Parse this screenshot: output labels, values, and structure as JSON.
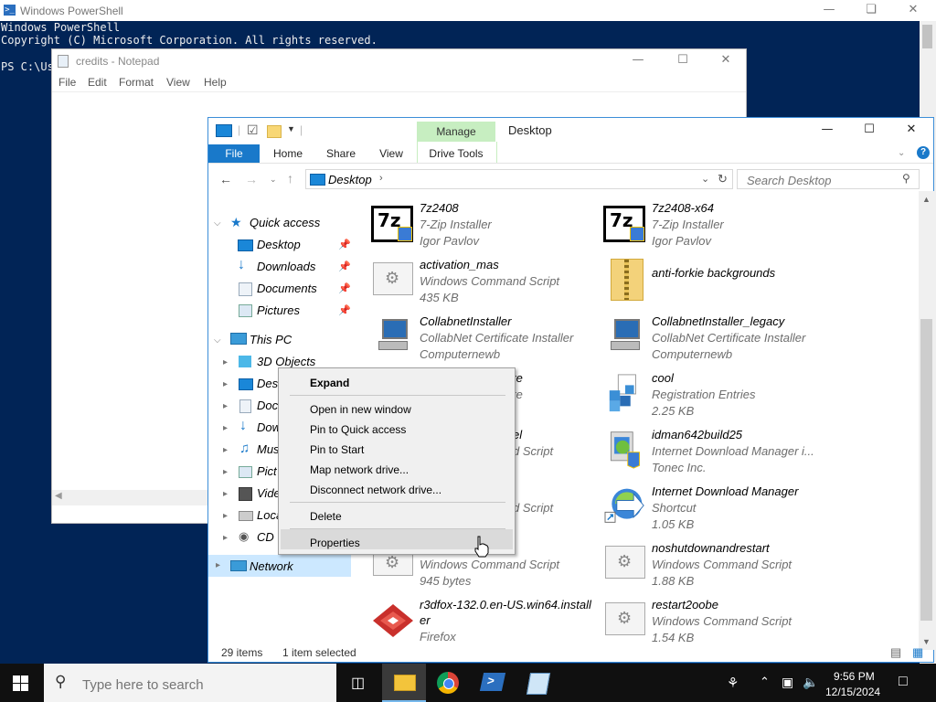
{
  "powershell": {
    "title": "Windows PowerShell",
    "line1": "Windows PowerShell",
    "line2": "Copyright (C) Microsoft Corporation. All rights reserved.",
    "prompt": "PS C:\\Us"
  },
  "notepad": {
    "title": "credits - Notepad",
    "menu": [
      "File",
      "Edit",
      "Format",
      "View",
      "Help"
    ]
  },
  "explorer": {
    "title": "Desktop",
    "manage_tab": "Manage",
    "tabs": {
      "file": "File",
      "home": "Home",
      "share": "Share",
      "view": "View",
      "drive_tools": "Drive Tools"
    },
    "address": "Desktop",
    "search_placeholder": "Search Desktop",
    "nav": {
      "quick_access": "Quick access",
      "qa_items": [
        "Desktop",
        "Downloads",
        "Documents",
        "Pictures"
      ],
      "this_pc": "This PC",
      "pc_items": [
        "3D Objects",
        "Desktop",
        "Documents",
        "Downloads",
        "Music",
        "Pictures",
        "Videos",
        "Local Disk (C:)",
        "CD Drive"
      ],
      "pc_items_visible": [
        "3D Objects",
        "Desi",
        "Doc",
        "Dow",
        "Mus",
        "Pict",
        "Vide",
        "Loca",
        "CD"
      ],
      "network": "Network"
    },
    "files_left": [
      {
        "name": "7z2408",
        "line2": "7-Zip Installer",
        "line3": "Igor Pavlov",
        "icon": "7zip-icon"
      },
      {
        "name": "activation_mas",
        "line2": "Windows Command Script",
        "line3": "435 KB",
        "icon": "script-icon"
      },
      {
        "name": "CollabnetInstaller",
        "line2": "CollabNet Certificate Installer",
        "line3": "Computernewb",
        "icon": "computer-icon"
      },
      {
        "name": "te",
        "line2": "te",
        "line3": "",
        "icon": "hidden"
      },
      {
        "name": "el",
        "line2": "d Script",
        "line3": "",
        "icon": "hidden"
      },
      {
        "name": "",
        "line2": "d Script",
        "line3": "",
        "icon": "hidden"
      },
      {
        "name": "",
        "line2": "Windows Command Script",
        "line3": "945 bytes",
        "icon": "script-icon"
      },
      {
        "name": "r3dfox-132.0.en-US.win64.install",
        "name2": "er",
        "line2": "Firefox",
        "line3": "",
        "icon": "r3dfox-icon"
      }
    ],
    "files_right": [
      {
        "name": "7z2408-x64",
        "line2": "7-Zip Installer",
        "line3": "Igor Pavlov",
        "icon": "7zip-icon"
      },
      {
        "name": "anti-forkie backgrounds",
        "line2": "",
        "line3": "",
        "icon": "zip-folder-icon"
      },
      {
        "name": "CollabnetInstaller_legacy",
        "line2": "CollabNet Certificate Installer",
        "line3": "Computernewb",
        "icon": "computer-icon"
      },
      {
        "name": "cool",
        "line2": "Registration Entries",
        "line3": "2.25 KB",
        "icon": "registry-icon"
      },
      {
        "name": "idman642build25",
        "line2": "Internet Download Manager i...",
        "line3": "Tonec Inc.",
        "icon": "idm-installer-icon"
      },
      {
        "name": "Internet Download Manager",
        "line2": "Shortcut",
        "line3": "1.05 KB",
        "icon": "idm-icon"
      },
      {
        "name": "noshutdownandrestart",
        "line2": "Windows Command Script",
        "line3": "1.88 KB",
        "icon": "script-icon"
      },
      {
        "name": "restart2oobe",
        "line2": "Windows Command Script",
        "line3": "1.54 KB",
        "icon": "script-icon"
      }
    ],
    "status_items": "29 items",
    "status_selected": "1 item selected"
  },
  "context_menu": {
    "expand": "Expand",
    "open_new_window": "Open in new window",
    "pin_quick_access": "Pin to Quick access",
    "pin_start": "Pin to Start",
    "map_drive": "Map network drive...",
    "disconnect_drive": "Disconnect network drive...",
    "delete": "Delete",
    "properties": "Properties"
  },
  "taskbar": {
    "search_placeholder": "Type here to search",
    "time": "9:56 PM",
    "date": "12/15/2024"
  },
  "colors": {
    "ps_bg": "#012456",
    "accent": "#1979ca",
    "manage": "#c7eec1"
  }
}
